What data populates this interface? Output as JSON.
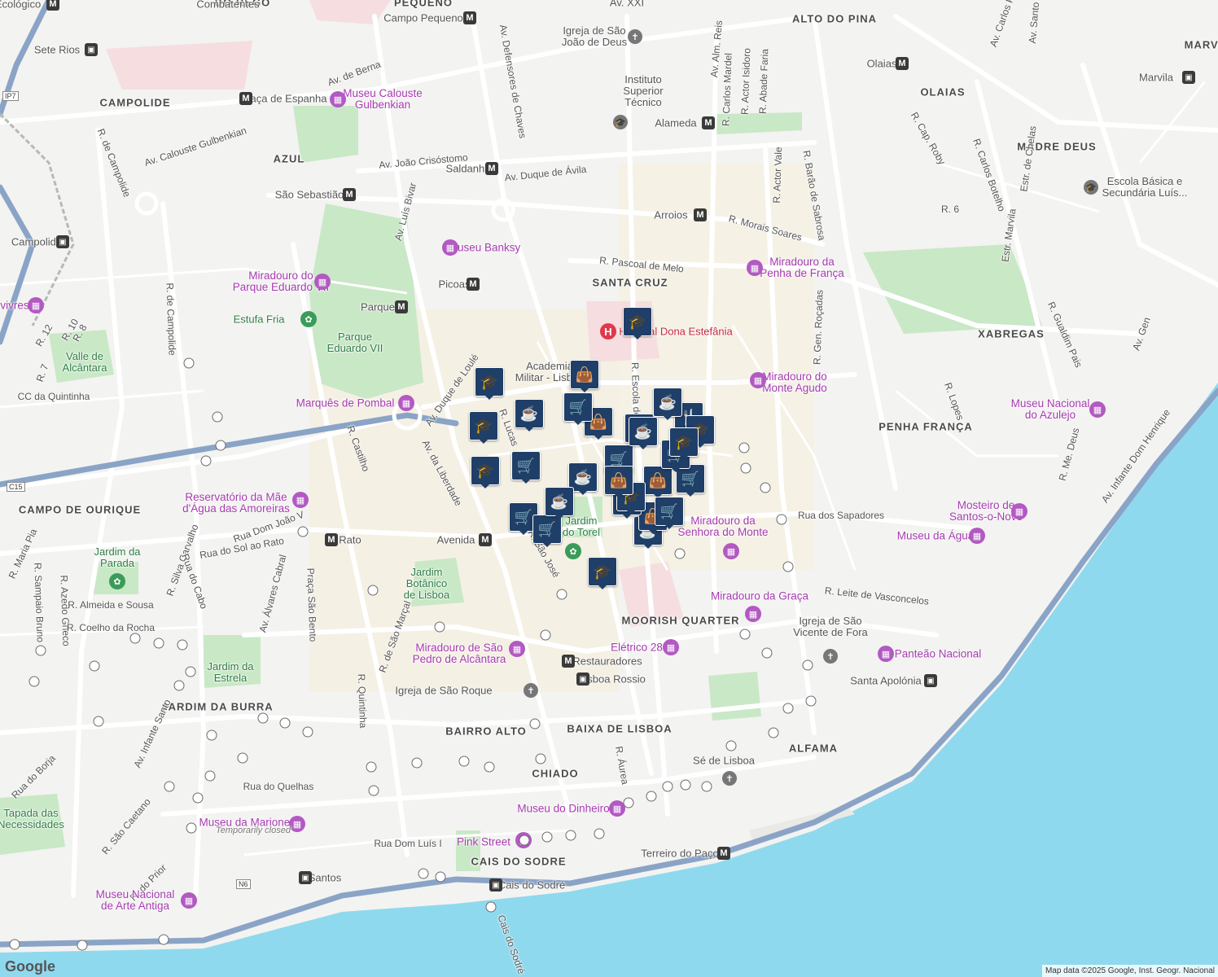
{
  "map": {
    "districts": [
      "ALTO DO PINA",
      "CAMPOLIDE",
      "AZUL",
      "OLAIAS",
      "MADRE DEUS",
      "SANTA CRUZ",
      "XABREGAS",
      "PENHA FRANÇA",
      "CAMPO DE OURIQUE",
      "MOORISH QUARTER",
      "JARDIM DA BURRA",
      "BAIRRO ALTO",
      "BAIXA DE LISBOA",
      "CHIADO",
      "ALFAMA",
      "CAIS DO SODRE",
      "MARVI",
      "PEQUENO",
      "DO REGO"
    ],
    "streets": [
      "Av. de Berna",
      "Av. Calouste Gulbenkian",
      "R. de Campolide",
      "Av. João Crisóstomo",
      "Av. Duque de Ávila",
      "Av. Luís Bivar",
      "Av. Defensores de Chaves",
      "Av. Alm. Reis",
      "R. Carlos Mardel",
      "R. Actor Isidoro",
      "R. Abade Faria",
      "R. Actor Vale",
      "R. Barão de Sabrosa",
      "R. Cap. Roby",
      "R. Carlos Botelho",
      "R. 6",
      "Estr. de Chelas",
      "Estr. Marvila",
      "R. Morais Soares",
      "R. Pascoal de Melo",
      "R. Gen. Roçadas",
      "R. Gualdim Pais",
      "R. Lopes",
      "R. Me. Deus",
      "Av. Infante Dom Henrique",
      "Rua dos Sapadores",
      "R. Leite de Vasconcelos",
      "Av. da Liberdade",
      "Av. Duque de Loulé",
      "R. Castilho",
      "R. de Campolide",
      "Rua Dom João V",
      "Rua do Sol ao Rato",
      "Av. Álvares Cabral",
      "Praça São Bento",
      "R. Silva Carvalho",
      "Rua do Cabo",
      "R. Maria Pia",
      "R. Sampaio Bruno",
      "R. Azedo Gneco",
      "R. Almeida e Sousa",
      "R. Coelho da Rocha",
      "R. de São Marçal",
      "R. Quintinha",
      "Av. Infante Santo",
      "Rua do Borja",
      "Rua do Quelhas",
      "R. São Caetano",
      "R. do Prior",
      "Rua Dom Luís I",
      "R. Áurea",
      "R. 12",
      "R. 10",
      "R. 8",
      "R. 7",
      "CC da Quintinha",
      "Av. Carlos Pi",
      "Av. Santo",
      "Cais do Sodré",
      "R. Escola do",
      "R. Lucas",
      "R. São José",
      "Av. Gen"
    ],
    "places": [
      {
        "name": "Campo Pequeno",
        "kind": "metro"
      },
      {
        "name": "Igreja de São João de Deus",
        "kind": "church"
      },
      {
        "name": "Sete Rios",
        "kind": "train"
      },
      {
        "name": "Praça de Espanha",
        "kind": "metro"
      },
      {
        "name": "Museu Calouste Gulbenkian",
        "kind": "museum"
      },
      {
        "name": "Instituto Superior Técnico",
        "kind": "school"
      },
      {
        "name": "Alameda",
        "kind": "metro"
      },
      {
        "name": "Olaias",
        "kind": "metro"
      },
      {
        "name": "Marvila",
        "kind": "train"
      },
      {
        "name": "Escola Básica e Secundária Luís...",
        "kind": "school"
      },
      {
        "name": "Saldanha",
        "kind": "metro"
      },
      {
        "name": "São Sebastião",
        "kind": "metro"
      },
      {
        "name": "Campolide",
        "kind": "train"
      },
      {
        "name": "Arroios",
        "kind": "metro"
      },
      {
        "name": "Museu Banksy",
        "kind": "museum"
      },
      {
        "name": "Miradouro do Parque Eduardo VII",
        "kind": "museum"
      },
      {
        "name": "Miradouro da Penha de França",
        "kind": "museum"
      },
      {
        "name": "Picoas",
        "kind": "metro"
      },
      {
        "name": "Parque",
        "kind": "metro"
      },
      {
        "name": "Estufa Fria",
        "kind": "park"
      },
      {
        "name": "Parque Eduardo VII",
        "kind": "park"
      },
      {
        "name": "Hospital Dona Estefânia",
        "kind": "hospital"
      },
      {
        "name": "Academia Militar - Lisboa",
        "kind": "place"
      },
      {
        "name": "Miradouro do Monte Agudo",
        "kind": "museum"
      },
      {
        "name": "Valle de Alcântara",
        "kind": "park"
      },
      {
        "name": "Marquês de Pombal",
        "kind": "museum"
      },
      {
        "name": "Museu Nacional do Azulejo",
        "kind": "museum"
      },
      {
        "name": "Reservatório da Mãe d'Água das Amoreiras",
        "kind": "museum"
      },
      {
        "name": "Mosteiro de Santos-o-Novo",
        "kind": "museum"
      },
      {
        "name": "Museu da Água",
        "kind": "museum"
      },
      {
        "name": "Miradouro da Senhora do Monte",
        "kind": "museum"
      },
      {
        "name": "Rato",
        "kind": "metro"
      },
      {
        "name": "Avenida",
        "kind": "metro"
      },
      {
        "name": "Jardim do Torel",
        "kind": "park"
      },
      {
        "name": "Jardim da Parada",
        "kind": "park"
      },
      {
        "name": "Jardim Botânico de Lisboa",
        "kind": "park"
      },
      {
        "name": "Miradouro da Graça",
        "kind": "museum"
      },
      {
        "name": "Igreja de São Vicente de Fora",
        "kind": "church"
      },
      {
        "name": "Panteão Nacional",
        "kind": "museum"
      },
      {
        "name": "Miradouro de São Pedro de Alcântara",
        "kind": "museum"
      },
      {
        "name": "Elétrico 28",
        "kind": "museum"
      },
      {
        "name": "Restauradores",
        "kind": "metro"
      },
      {
        "name": "Lisboa Rossio",
        "kind": "train"
      },
      {
        "name": "Jardim da Estrela",
        "kind": "park"
      },
      {
        "name": "Igreja de São Roque",
        "kind": "church"
      },
      {
        "name": "Santa Apolónia",
        "kind": "train"
      },
      {
        "name": "Sé de Lisboa",
        "kind": "church"
      },
      {
        "name": "Museu do Dinheiro",
        "kind": "museum"
      },
      {
        "name": "Tapada das Necessidades",
        "kind": "park"
      },
      {
        "name": "Museu da Marioneta",
        "kind": "museum"
      },
      {
        "name": "Temporarily closed",
        "kind": "note"
      },
      {
        "name": "Pink Street",
        "kind": "museum"
      },
      {
        "name": "Terreiro do Paço",
        "kind": "metro"
      },
      {
        "name": "Santos",
        "kind": "train"
      },
      {
        "name": "Cais do Sodré",
        "kind": "train"
      },
      {
        "name": "Museu Nacional de Arte Antiga",
        "kind": "museum"
      },
      {
        "name": "Ecológico",
        "kind": "metro"
      },
      {
        "name": "Combatentes",
        "kind": "place"
      },
      {
        "name": "vivres",
        "kind": "museum"
      },
      {
        "name": "Av. XXI",
        "kind": "place"
      }
    ],
    "road_shields": [
      "IP7",
      "C15",
      "N6"
    ],
    "markers": [
      "cart",
      "cart",
      "cart",
      "cart",
      "coffee",
      "coffee",
      "coffee",
      "coffee",
      "coffee",
      "bag",
      "bag",
      "bag",
      "bag",
      "school",
      "school",
      "school",
      "school",
      "school",
      "school",
      "restaurant"
    ],
    "footer": "Map data ©2025 Google, Inst. Geogr. Nacional",
    "logo": "Google",
    "colors": {
      "water": "#8fd9ee",
      "park": "#c9e8c6",
      "road": "#ffffff",
      "highway": "#8aa4c7",
      "hospital": "#f5dde0",
      "marker": "#1f3f68"
    }
  }
}
